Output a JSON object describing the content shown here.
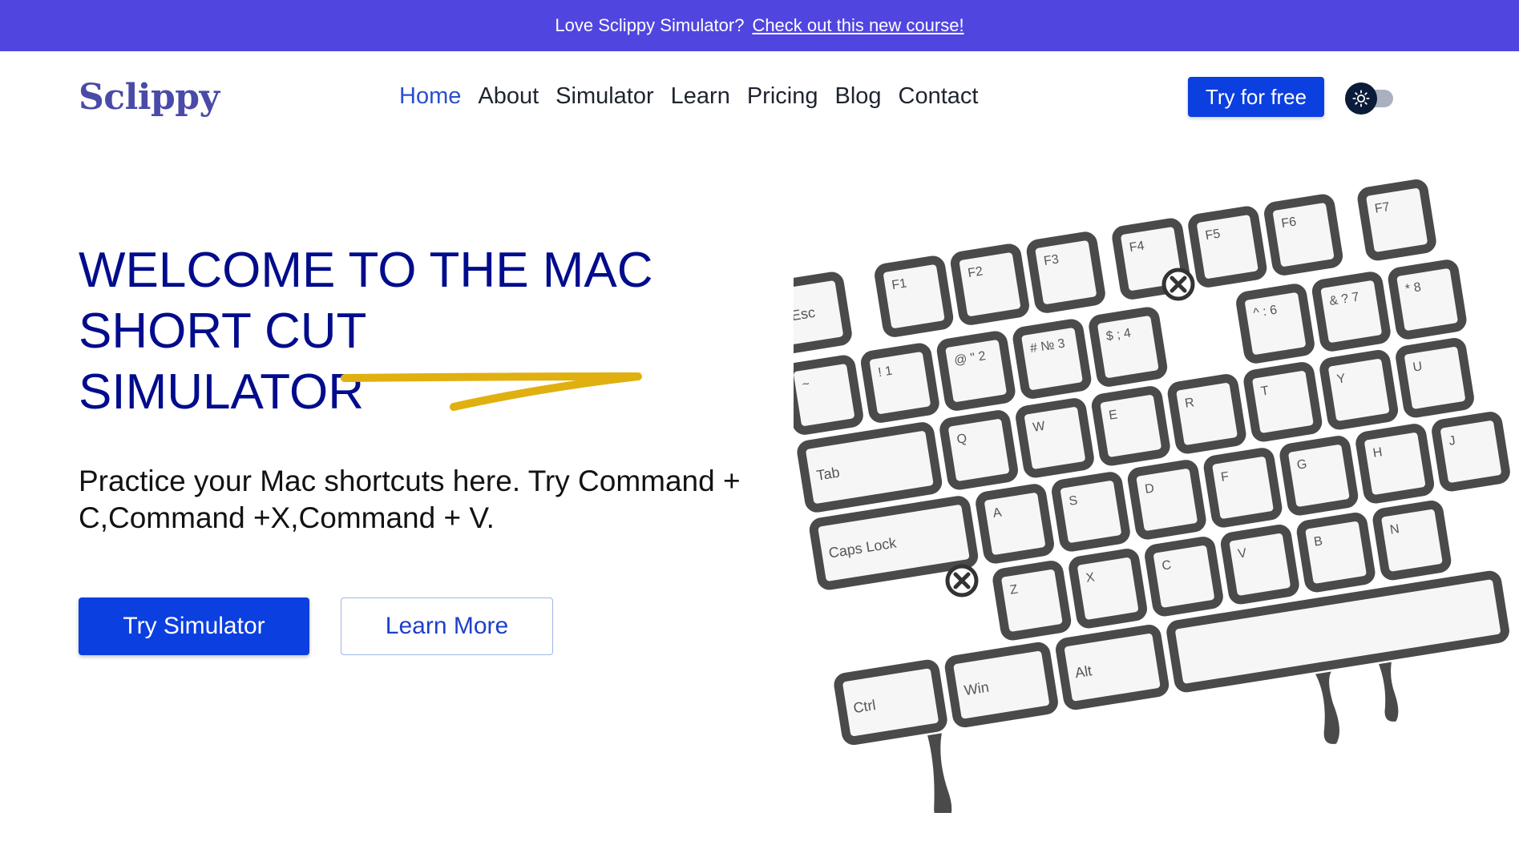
{
  "announcement": {
    "text": "Love Sclippy Simulator?",
    "link_label": "Check out this new course!"
  },
  "header": {
    "logo": "Sclippy",
    "nav": [
      "Home",
      "About",
      "Simulator",
      "Learn",
      "Pricing",
      "Blog",
      "Contact"
    ],
    "active_nav": "Home",
    "cta_label": "Try for free",
    "theme_toggle_icon": "sun-icon"
  },
  "hero": {
    "title_line1": "WELCOME TO THE MAC",
    "title_line2": "SHORT CUT SIMULATOR",
    "subtitle": "Practice your Mac shortcuts here. Try Command + C,Command +X,Command + V.",
    "primary_button": "Try Simulator",
    "secondary_button": "Learn More"
  },
  "keyboard": {
    "keys": [
      "Esc",
      "F1",
      "F2",
      "F3",
      "F4",
      "F5",
      "F6",
      "F7",
      "~",
      "! 1",
      "@ \" 2",
      "# № 3",
      "$ ; 4",
      "^ : 6",
      "& ? 7",
      "* 8",
      "Tab",
      "Q",
      "W",
      "E",
      "R",
      "T",
      "Y",
      "U",
      "Caps Lock",
      "A",
      "S",
      "D",
      "F",
      "G",
      "H",
      "J",
      "Z",
      "X",
      "C",
      "V",
      "B",
      "N",
      "Ctrl",
      "Win",
      "Alt"
    ],
    "removed_key_icon": "x-circle-icon"
  },
  "colors": {
    "announcement_bg": "#5145e0",
    "primary": "#0c3fe0",
    "title": "#000c8c",
    "accent_stroke": "#e0b010",
    "key_border": "#4a4a4a"
  }
}
